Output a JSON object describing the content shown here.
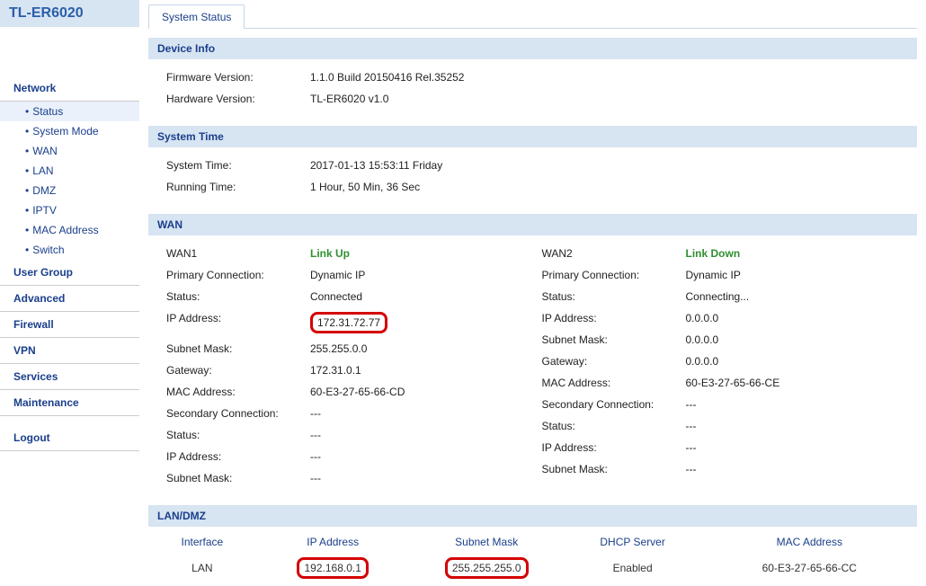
{
  "brand": "TL-ER6020",
  "tabs": {
    "system_status": "System Status"
  },
  "nav": {
    "network": "Network",
    "status": "Status",
    "system_mode": "System Mode",
    "wan": "WAN",
    "lan": "LAN",
    "dmz": "DMZ",
    "iptv": "IPTV",
    "mac_address": "MAC Address",
    "switch": "Switch",
    "user_group": "User Group",
    "advanced": "Advanced",
    "firewall": "Firewall",
    "vpn": "VPN",
    "services": "Services",
    "maintenance": "Maintenance",
    "logout": "Logout"
  },
  "device_info": {
    "header": "Device Info",
    "firmware_label": "Firmware Version:",
    "firmware_value": "1.1.0 Build 20150416 Rel.35252",
    "hardware_label": "Hardware Version:",
    "hardware_value": "TL-ER6020 v1.0"
  },
  "system_time": {
    "header": "System Time",
    "system_time_label": "System Time:",
    "system_time_value": "2017-01-13 15:53:11 Friday",
    "running_time_label": "Running Time:",
    "running_time_value": "1 Hour, 50 Min, 36 Sec"
  },
  "wan": {
    "header": "WAN",
    "labels": {
      "primary_connection": "Primary Connection:",
      "status": "Status:",
      "ip_address": "IP Address:",
      "subnet_mask": "Subnet Mask:",
      "gateway": "Gateway:",
      "mac_address": "MAC Address:",
      "secondary_connection": "Secondary Connection:"
    },
    "wan1": {
      "title": "WAN1",
      "link": "Link Up",
      "primary": "Dynamic IP",
      "status": "Connected",
      "ip": "172.31.72.77",
      "mask": "255.255.0.0",
      "gateway": "172.31.0.1",
      "mac": "60-E3-27-65-66-CD",
      "secondary": "---",
      "sec_status": "---",
      "sec_ip": "---",
      "sec_mask": "---"
    },
    "wan2": {
      "title": "WAN2",
      "link": "Link Down",
      "primary": "Dynamic IP",
      "status": "Connecting...",
      "ip": "0.0.0.0",
      "mask": "0.0.0.0",
      "gateway": "0.0.0.0",
      "mac": "60-E3-27-65-66-CE",
      "secondary": "---",
      "sec_status": "---",
      "sec_ip": "---",
      "sec_mask": "---"
    }
  },
  "lan_dmz": {
    "header": "LAN/DMZ",
    "columns": {
      "interface": "Interface",
      "ip": "IP Address",
      "mask": "Subnet Mask",
      "dhcp": "DHCP Server",
      "mac": "MAC Address"
    },
    "row": {
      "interface": "LAN",
      "ip": "192.168.0.1",
      "mask": "255.255.255.0",
      "dhcp": "Enabled",
      "mac": "60-E3-27-65-66-CC"
    }
  }
}
